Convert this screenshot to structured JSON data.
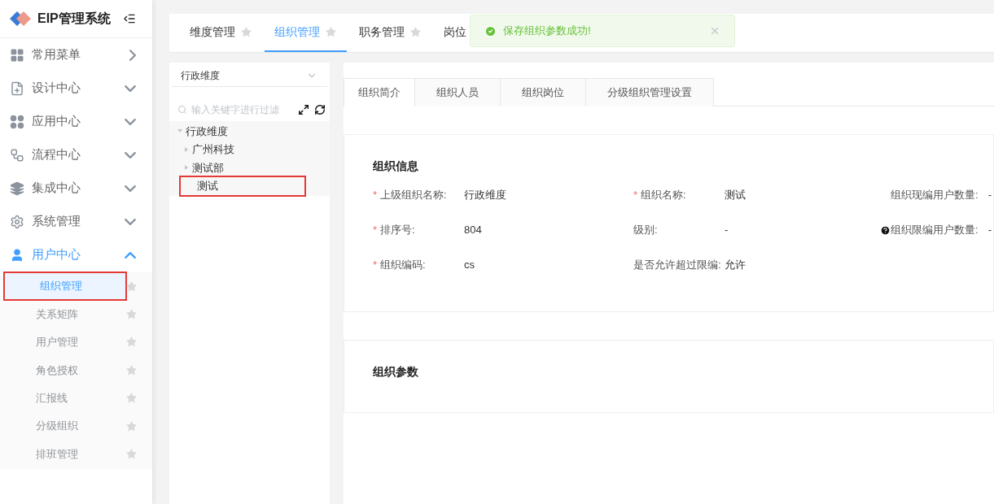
{
  "brand": {
    "title": "EIP管理系统"
  },
  "menu": [
    {
      "label": "常用菜单",
      "kind": "flyout",
      "expanded": false
    },
    {
      "label": "设计中心",
      "kind": "group",
      "expanded": false
    },
    {
      "label": "应用中心",
      "kind": "group",
      "expanded": false
    },
    {
      "label": "流程中心",
      "kind": "group",
      "expanded": false
    },
    {
      "label": "集成中心",
      "kind": "group",
      "expanded": false
    },
    {
      "label": "系统管理",
      "kind": "group",
      "expanded": false
    },
    {
      "label": "用户中心",
      "kind": "group",
      "expanded": true,
      "children": [
        {
          "label": "组织管理",
          "selected": true,
          "highlighted": true
        },
        {
          "label": "关系矩阵",
          "selected": false,
          "highlighted": false
        },
        {
          "label": "用户管理",
          "selected": false,
          "highlighted": false
        },
        {
          "label": "角色授权",
          "selected": false,
          "highlighted": false
        },
        {
          "label": "汇报线",
          "selected": false,
          "highlighted": false
        },
        {
          "label": "分级组织",
          "selected": false,
          "highlighted": false
        },
        {
          "label": "排班管理",
          "selected": false,
          "highlighted": false
        }
      ]
    }
  ],
  "page_tabs": [
    {
      "label": "维度管理",
      "selected": false,
      "star": true
    },
    {
      "label": "组织管理",
      "selected": true,
      "star": true
    },
    {
      "label": "职务管理",
      "selected": false,
      "star": true
    },
    {
      "label": "岗位",
      "selected": false,
      "star": false
    }
  ],
  "toast": {
    "message": "保存组织参数成功!"
  },
  "tree_panel": {
    "dimension": "行政维度",
    "search": {
      "placeholder": "输入关键字进行过滤"
    },
    "nodes": [
      {
        "label": "行政维度",
        "kind": "branch",
        "expanded": true,
        "highlighted": false,
        "children": [
          {
            "label": "广州科技",
            "kind": "branch",
            "expanded": false,
            "highlighted": false
          },
          {
            "label": "测试部",
            "kind": "branch",
            "expanded": false,
            "highlighted": false
          },
          {
            "label": "测试",
            "kind": "leaf",
            "expanded": false,
            "highlighted": true
          }
        ]
      }
    ]
  },
  "detail_tabs": [
    {
      "label": "组织简介",
      "selected": true
    },
    {
      "label": "组织人员",
      "selected": false
    },
    {
      "label": "组织岗位",
      "selected": false
    },
    {
      "label": "分级组织管理设置",
      "selected": false
    }
  ],
  "org_info": {
    "title": "组织信息",
    "fields": [
      {
        "marker": "*",
        "label": "上级组织名称:",
        "value": "行政维度",
        "help": false
      },
      {
        "marker": "*",
        "label": "组织名称:",
        "value": "测试",
        "help": false
      },
      {
        "label": "组织现编用户数量:",
        "value": "-",
        "help": false
      },
      {
        "marker": "*",
        "label": "排序号:",
        "value": "804",
        "help": false
      },
      {
        "label": "级别:",
        "value": "-",
        "help": false
      },
      {
        "label": "组织限编用户数量:",
        "value": "-",
        "help": true
      },
      {
        "marker": "*",
        "label": "组织编码:",
        "value": "cs",
        "help": false
      },
      {
        "label": "是否允许超过限编:",
        "value": "允许",
        "help": false
      }
    ]
  },
  "org_params": {
    "title": "组织参数"
  }
}
